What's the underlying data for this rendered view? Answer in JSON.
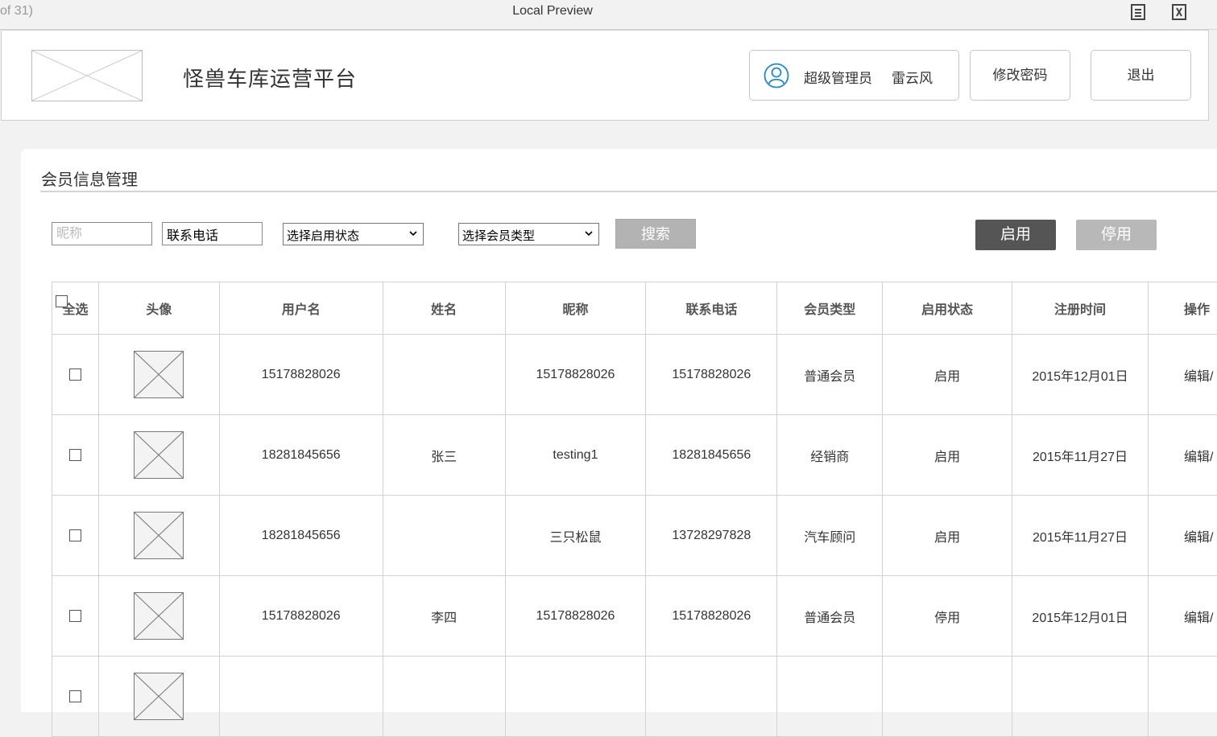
{
  "preview_bar": {
    "page_count": "of 31)",
    "title": "Local Preview",
    "icons": [
      "document-icon",
      "close-frame-icon"
    ]
  },
  "header": {
    "app_title": "怪兽车库运营平台",
    "user_role": "超级管理员",
    "user_name": "雷云风",
    "change_password_label": "修改密码",
    "logout_label": "退出"
  },
  "panel": {
    "title": "会员信息管理"
  },
  "filters": {
    "nickname_placeholder": "昵称",
    "phone_value": "联系电话",
    "status_select": "选择启用状态",
    "member_type_select": "选择会员类型",
    "search_label": "搜索",
    "enable_label": "启用",
    "disable_label": "停用"
  },
  "table": {
    "select_all_label": "全选",
    "columns": [
      "头像",
      "用户名",
      "姓名",
      "昵称",
      "联系电话",
      "会员类型",
      "启用状态",
      "注册时间",
      "操作"
    ],
    "rows": [
      {
        "username": "15178828026",
        "name": "",
        "nickname": "15178828026",
        "phone": "15178828026",
        "member_type": "普通会员",
        "status": "启用",
        "register_time": "2015年12月01日",
        "ops": "编辑/"
      },
      {
        "username": "18281845656",
        "name": "张三",
        "nickname": "testing1",
        "phone": "18281845656",
        "member_type": "经销商",
        "status": "启用",
        "register_time": "2015年11月27日",
        "ops": "编辑/"
      },
      {
        "username": "18281845656",
        "name": "",
        "nickname": "三只松鼠",
        "phone": "13728297828",
        "member_type": "汽车顾问",
        "status": "启用",
        "register_time": "2015年11月27日",
        "ops": "编辑/"
      },
      {
        "username": "15178828026",
        "name": "李四",
        "nickname": "15178828026",
        "phone": "15178828026",
        "member_type": "普通会员",
        "status": "停用",
        "register_time": "2015年12月01日",
        "ops": "编辑/"
      },
      {
        "username": "",
        "name": "",
        "nickname": "",
        "phone": "",
        "member_type": "",
        "status": "",
        "register_time": "",
        "ops": ""
      }
    ]
  }
}
